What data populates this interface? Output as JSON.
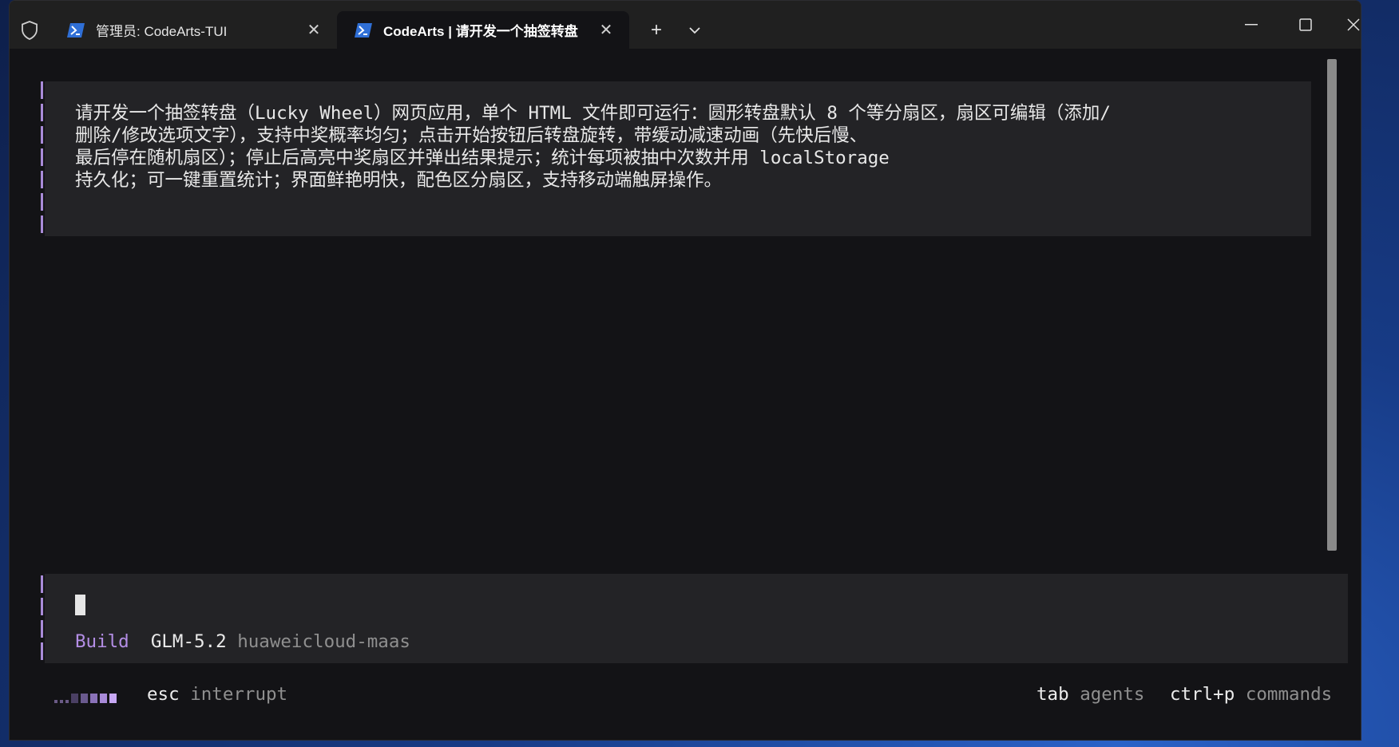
{
  "titlebar": {
    "tabs": [
      {
        "label": "管理员: CodeArts-TUI",
        "active": false
      },
      {
        "label": "CodeArts | 请开发一个抽签转盘",
        "active": true
      }
    ],
    "new_tab_symbol": "+",
    "icons": [
      "shield-icon",
      "powershell-icon",
      "close-icon",
      "plus-icon",
      "chevron-down-icon",
      "minimize-icon",
      "maximize-icon",
      "window-close-icon"
    ]
  },
  "conversation": {
    "user_message_lines": [
      "请开发一个抽签转盘（Lucky Wheel）网页应用，单个 HTML 文件即可运行：圆形转盘默认 8 个等分扇区，扇区可编辑（添加/",
      "删除/修改选项文字），支持中奖概率均匀；点击开始按钮后转盘旋转，带缓动减速动画（先快后慢、",
      "最后停在随机扇区）；停止后高亮中奖扇区并弹出结果提示；统计每项被抽中次数并用 localStorage",
      "持久化；可一键重置统计；界面鲜艳明快，配色区分扇区，支持移动端触屏操作。"
    ]
  },
  "prompt": {
    "mode": "Build",
    "model": "GLM-5.2",
    "provider": "huaweicloud-maas"
  },
  "statusbar": {
    "left_key": "esc",
    "left_desc": "interrupt",
    "right": [
      {
        "key": "tab",
        "desc": "agents"
      },
      {
        "key": "ctrl+p",
        "desc": "commands"
      }
    ]
  },
  "colors": {
    "accent": "#b48ee6",
    "background": "#131316",
    "panel": "#232326",
    "muted": "#8f8f8f"
  }
}
